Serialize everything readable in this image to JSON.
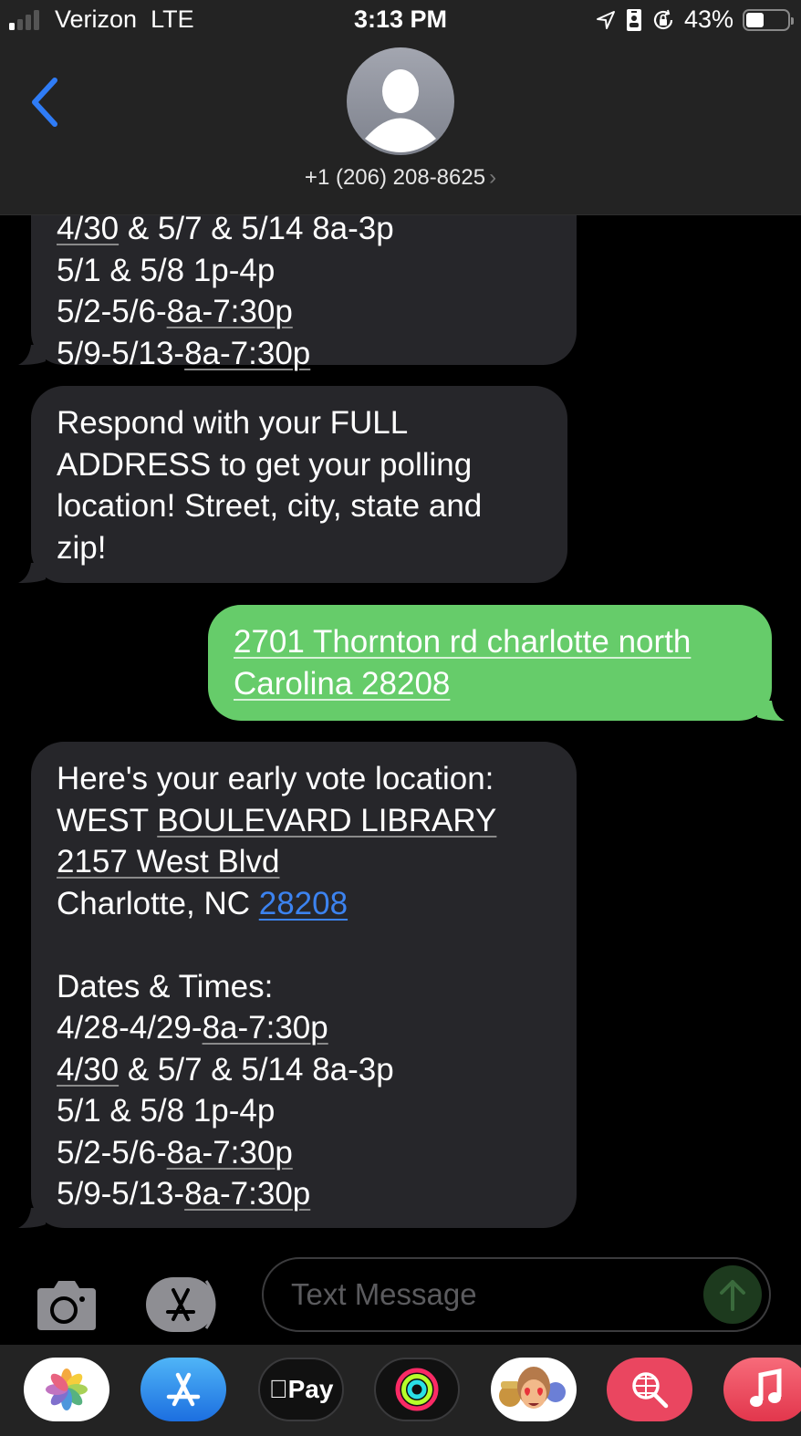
{
  "status_bar": {
    "carrier": "Verizon",
    "network": "LTE",
    "time": "3:13 PM",
    "battery_percent_label": "43%",
    "battery_level": 0.43,
    "signal_bars": 1,
    "signal_bars_total": 4,
    "icons": [
      "location-arrow-icon",
      "contact-card-icon",
      "orientation-lock-icon"
    ]
  },
  "header": {
    "back_icon": "chevron-left-icon",
    "contact": "+1 (206) 208-8625",
    "contact_chevron": "›",
    "avatar_icon": "person-silhouette-icon"
  },
  "colors": {
    "incoming_bubble": "#26262a",
    "outgoing_bubble": "#66cc6a",
    "link": "#3c83f0",
    "back_chevron": "#2f7cf6"
  },
  "messages": [
    {
      "direction": "incoming",
      "partial": true,
      "lines": [
        {
          "parts": [
            {
              "t": "4/30",
              "u": true
            },
            {
              "t": " & 5/7 & 5/14 8a-3p"
            }
          ]
        },
        {
          "parts": [
            {
              "t": "5/1 & 5/8 1p-4p"
            }
          ]
        },
        {
          "parts": [
            {
              "t": "5/2-5/6-"
            },
            {
              "t": "8a-7:30p",
              "u": true
            }
          ]
        },
        {
          "parts": [
            {
              "t": "5/9-5/13-"
            },
            {
              "t": "8a-7:30p",
              "u": true
            }
          ]
        }
      ]
    },
    {
      "direction": "incoming",
      "lines": [
        {
          "parts": [
            {
              "t": "Respond with your FULL"
            }
          ]
        },
        {
          "parts": [
            {
              "t": "ADDRESS to get your polling"
            }
          ]
        },
        {
          "parts": [
            {
              "t": "location! Street, city, state and"
            }
          ]
        },
        {
          "parts": [
            {
              "t": "zip!"
            }
          ]
        }
      ]
    },
    {
      "direction": "outgoing",
      "lines": [
        {
          "parts": [
            {
              "t": "2701 Thornton rd charlotte north",
              "u": true
            }
          ]
        },
        {
          "parts": [
            {
              "t": "Carolina 28208",
              "u": true
            }
          ]
        }
      ]
    },
    {
      "direction": "incoming",
      "lines": [
        {
          "parts": [
            {
              "t": "Here's your early vote location:"
            }
          ]
        },
        {
          "parts": [
            {
              "t": "WEST "
            },
            {
              "t": "BOULEVARD LIBRARY",
              "u": true
            }
          ]
        },
        {
          "parts": [
            {
              "t": "2157 West Blvd",
              "u": true
            }
          ]
        },
        {
          "parts": [
            {
              "t": "Charlotte, NC "
            },
            {
              "t": "28208",
              "link": true
            }
          ]
        },
        {
          "parts": [
            {
              "t": ""
            }
          ]
        },
        {
          "parts": [
            {
              "t": "Dates & Times:"
            }
          ]
        },
        {
          "parts": [
            {
              "t": "4/28-4/29-"
            },
            {
              "t": "8a-7:30p",
              "u": true
            }
          ]
        },
        {
          "parts": [
            {
              "t": "4/30",
              "u": true
            },
            {
              "t": " & 5/7 & 5/14 8a-3p"
            }
          ]
        },
        {
          "parts": [
            {
              "t": "5/1 & 5/8 1p-4p"
            }
          ]
        },
        {
          "parts": [
            {
              "t": "5/2-5/6-"
            },
            {
              "t": "8a-7:30p",
              "u": true
            }
          ]
        },
        {
          "parts": [
            {
              "t": "5/9-5/13-"
            },
            {
              "t": "8a-7:30p",
              "u": true
            }
          ]
        }
      ]
    }
  ],
  "composer": {
    "placeholder": "Text Message",
    "value": "",
    "camera_icon": "camera-icon",
    "apps_icon": "app-store-icon",
    "send_icon": "arrow-up-icon"
  },
  "app_drawer": {
    "apps": [
      {
        "name": "Photos",
        "icon": "photos-icon"
      },
      {
        "name": "App Store",
        "icon": "app-store-icon"
      },
      {
        "name": "Apple Pay",
        "icon": "apple-pay-icon",
        "label": "Pay"
      },
      {
        "name": "Activity",
        "icon": "activity-rings-icon"
      },
      {
        "name": "Memoji Stickers",
        "icon": "memoji-icon"
      },
      {
        "name": "Images Search",
        "icon": "globe-search-icon"
      },
      {
        "name": "Music",
        "icon": "music-note-icon"
      }
    ]
  }
}
